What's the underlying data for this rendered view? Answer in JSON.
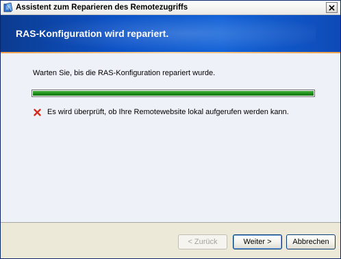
{
  "window": {
    "title": "Assistent zum Reparieren des Remotezugriffs"
  },
  "header": {
    "title": "RAS-Konfiguration wird repariert."
  },
  "main": {
    "status_text": "Warten Sie, bis die RAS-Konfiguration repariert wurde.",
    "progress_fraction": 1.0,
    "check_item": "Es wird überprüft, ob Ihre Remotewebsite lokal aufgerufen werden kann.",
    "check_status_icon": "error-x-icon"
  },
  "buttons": {
    "back": "< Zurück",
    "next": "Weiter >",
    "cancel": "Abbrechen"
  },
  "colors": {
    "header_blue": "#0d53c8",
    "progress_green": "#1e8d1a",
    "error_red": "#d42a1c",
    "accent_orange": "#f0a24a"
  }
}
